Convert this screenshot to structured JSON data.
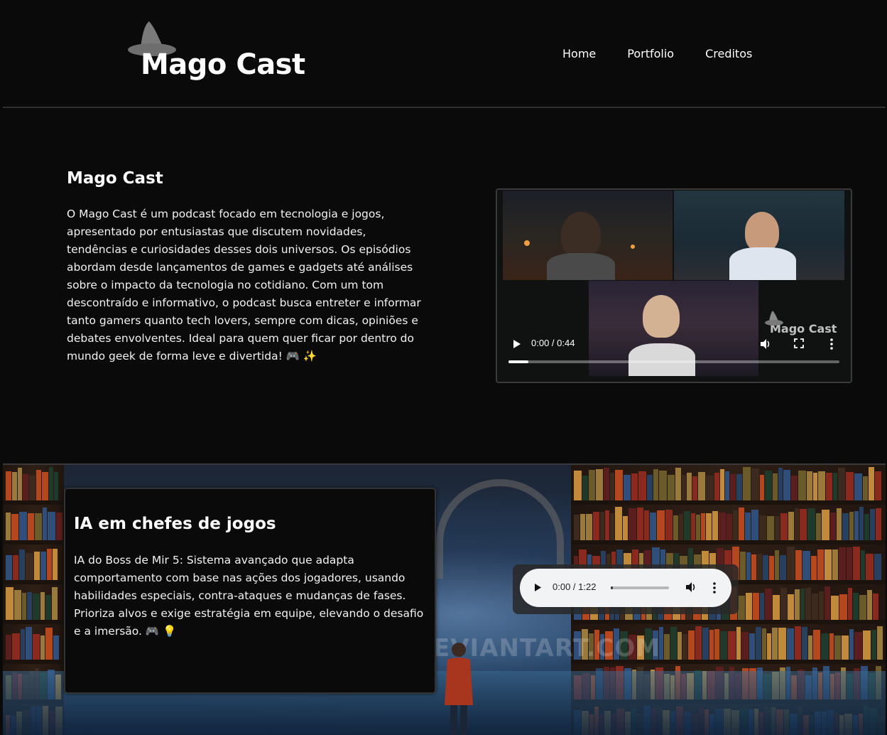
{
  "header": {
    "brand": "Mago Cast",
    "nav": [
      "Home",
      "Portfolio",
      "Creditos"
    ]
  },
  "about": {
    "title": "Mago Cast",
    "text": "O Mago Cast é um podcast focado em tecnologia e jogos, apresentado por entusiastas que discutem novidades, tendências e curiosidades desses dois universos. Os episódios abordam desde lançamentos de games e gadgets até análises sobre o impacto da tecnologia no cotidiano. Com um tom descontraído e informativo, o podcast busca entreter e informar tanto gamers quanto tech lovers, sempre com dicas, opiniões e debates envolventes. Ideal para quem quer ficar por dentro do mundo geek de forma leve e divertida! 🎮 ✨"
  },
  "video": {
    "watermark": "Mago Cast",
    "time": "0:00 / 0:44",
    "progress": 0.06
  },
  "episode": {
    "title": "IA em chefes de jogos",
    "text": "IA do Boss de Mir 5: Sistema avançado que adapta comportamento com base nas ações dos jogadores, usando habilidades especiais, contra-ataques e mudanças de fases. Prioriza alvos e exige estratégia em equipe, elevando o desafio e a imersão. 🎮 💡",
    "audio_time": "0:00 / 1:22",
    "audio_progress": 0.04,
    "background_watermark": "EVIANTART.COM"
  },
  "colors": {
    "background": "#0a0a0b",
    "text": "#ffffff",
    "hat": "#7a7a7a"
  }
}
